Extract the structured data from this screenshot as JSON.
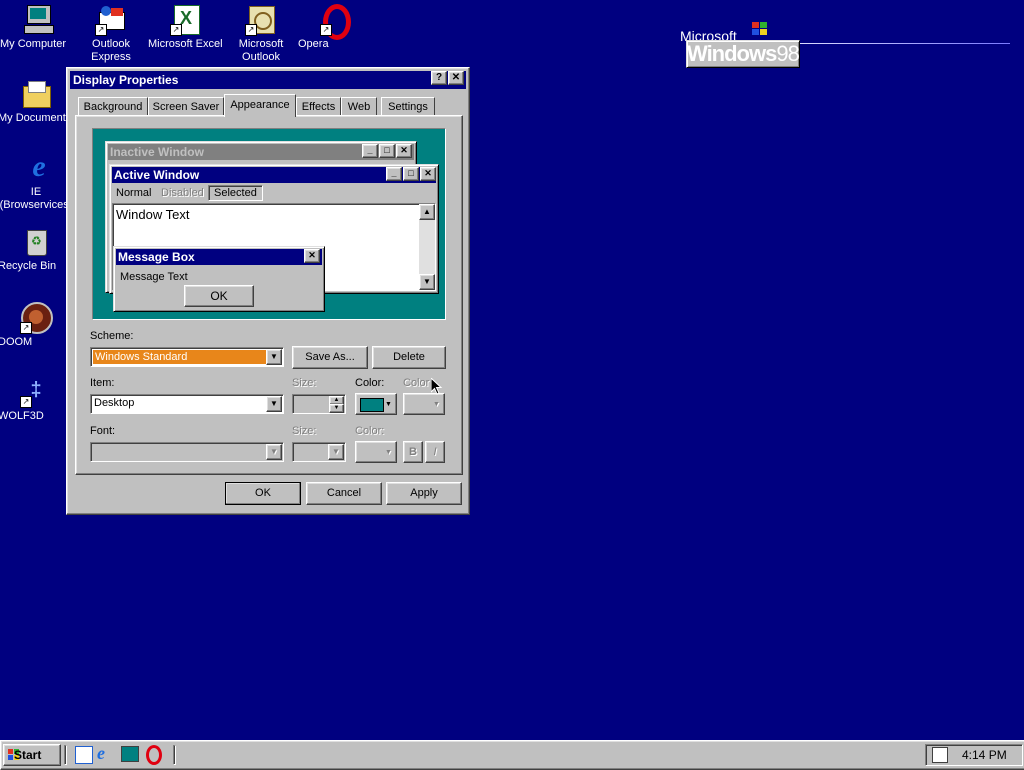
{
  "desktop": {
    "icons": [
      {
        "label": "My Computer"
      },
      {
        "label": "Outlook Express"
      },
      {
        "label": "Microsoft Excel"
      },
      {
        "label": "Microsoft Outlook"
      },
      {
        "label": "Opera"
      },
      {
        "label": "My Documents"
      },
      {
        "label": "IE (Browservices)"
      },
      {
        "label": "Recycle Bin"
      },
      {
        "label": "DOOM"
      },
      {
        "label": "WOLF3D"
      }
    ],
    "logo_brand": "Microsoft",
    "logo_product": "Windows",
    "logo_version": "98"
  },
  "dialog": {
    "title": "Display Properties",
    "help_btn": "?",
    "close_btn": "✕",
    "tabs": [
      {
        "label": "Background"
      },
      {
        "label": "Screen Saver"
      },
      {
        "label": "Appearance"
      },
      {
        "label": "Effects"
      },
      {
        "label": "Web"
      },
      {
        "label": "Settings"
      }
    ],
    "preview": {
      "inactive_title": "Inactive Window",
      "active_title": "Active Window",
      "menu_normal": "Normal",
      "menu_disabled": "Disabled",
      "menu_selected": "Selected",
      "window_text": "Window Text",
      "msgbox_title": "Message Box",
      "msgbox_text": "Message Text",
      "msgbox_ok": "OK"
    },
    "scheme_label": "Scheme:",
    "scheme_value": "Windows Standard",
    "save_as": "Save As...",
    "delete": "Delete",
    "item_label": "Item:",
    "item_value": "Desktop",
    "size_label": "Size:",
    "color_label": "Color:",
    "color2_label": "Color",
    "desktop_color": "#008080",
    "font_label": "Font:",
    "font_size_label": "Size:",
    "font_color_label": "Color:",
    "bold_btn": "B",
    "italic_btn": "I",
    "ok": "OK",
    "cancel": "Cancel",
    "apply": "Apply"
  },
  "taskbar": {
    "start": "Start",
    "clock": "4:14 PM"
  }
}
